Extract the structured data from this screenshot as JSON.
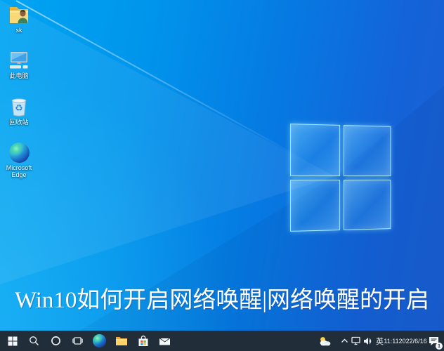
{
  "desktop": {
    "icons": [
      {
        "label": "sk",
        "icon": "user-folder-icon"
      },
      {
        "label": "此电脑",
        "icon": "this-pc-icon"
      },
      {
        "label": "回收站",
        "icon": "recycle-bin-icon"
      },
      {
        "label": "Microsoft Edge",
        "icon": "edge-icon"
      }
    ]
  },
  "banner": {
    "text": "Win10如何开启网络唤醒|网络唤醒的开启"
  },
  "taskbar": {
    "buttons": [
      {
        "name": "start",
        "icon": "windows-logo-icon"
      },
      {
        "name": "search",
        "icon": "search-icon"
      },
      {
        "name": "cortana",
        "icon": "cortana-circle-icon"
      },
      {
        "name": "task-view",
        "icon": "task-view-icon"
      },
      {
        "name": "edge",
        "icon": "edge-icon"
      },
      {
        "name": "file-explorer",
        "icon": "folder-icon"
      },
      {
        "name": "microsoft-store",
        "icon": "store-bag-icon"
      },
      {
        "name": "mail",
        "icon": "mail-envelope-icon"
      }
    ],
    "tray": {
      "weather_icon": "partly-cloudy-icon",
      "ime_label": "英",
      "clock": {
        "time": "11:11",
        "date": "2022/6/16"
      },
      "notification_badge_count": "1"
    }
  },
  "colors": {
    "wallpaper_left": "#00a5f2",
    "wallpaper_right": "#1a5ed2",
    "logo_pane_edge": "#afeeff",
    "taskbar": "#212d39",
    "banner_text": "#ffffff",
    "store_red": "#f25022",
    "store_green": "#7fba00",
    "store_blue": "#00a4ef",
    "store_yellow": "#ffb900"
  }
}
